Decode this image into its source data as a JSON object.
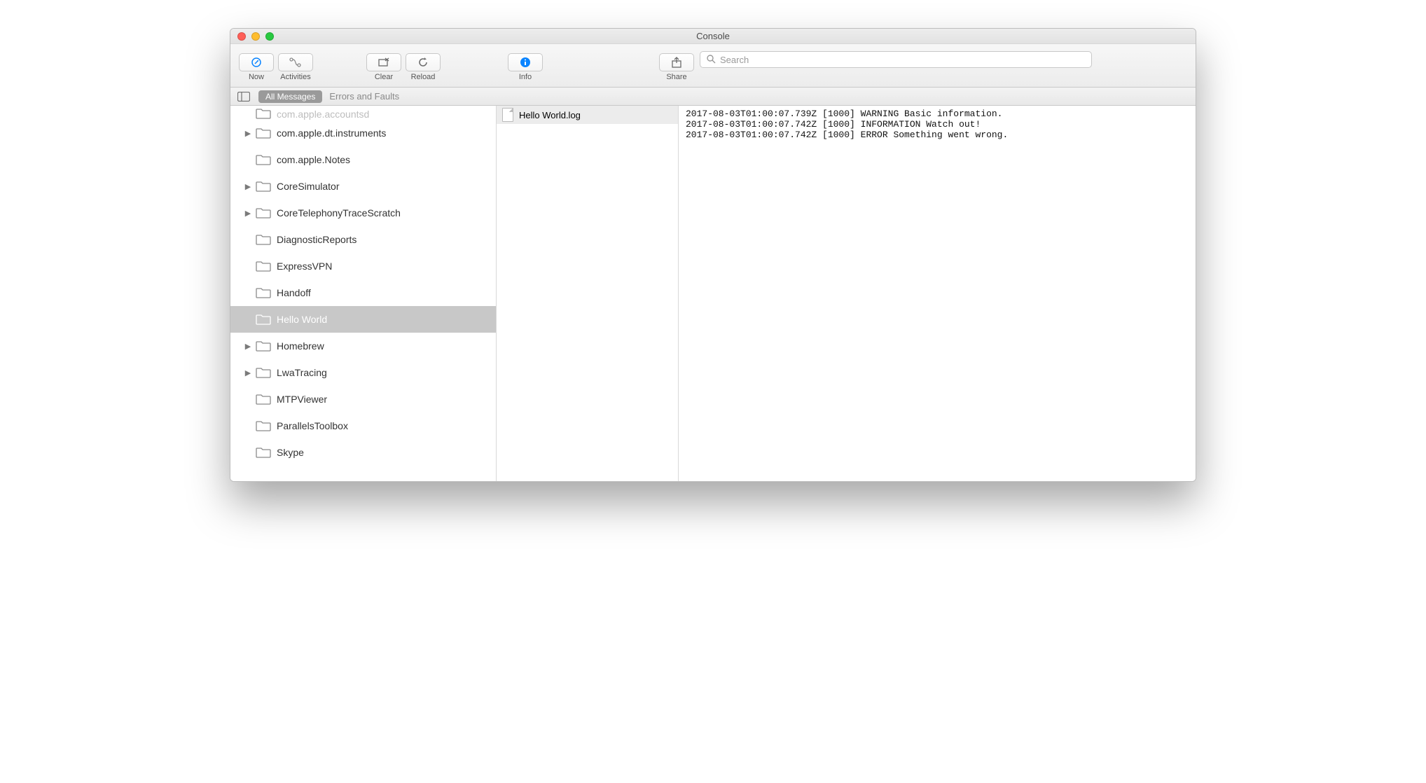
{
  "window": {
    "title": "Console"
  },
  "toolbar": {
    "now": "Now",
    "activities": "Activities",
    "clear": "Clear",
    "reload": "Reload",
    "info": "Info",
    "share": "Share",
    "search_placeholder": "Search"
  },
  "filter": {
    "all_messages": "All Messages",
    "errors_and_faults": "Errors and Faults"
  },
  "sidebar": {
    "items": [
      {
        "label": "com.apple.accountsd",
        "expandable": false,
        "selected": false,
        "topcut": true
      },
      {
        "label": "com.apple.dt.instruments",
        "expandable": true,
        "selected": false
      },
      {
        "label": "com.apple.Notes",
        "expandable": false,
        "selected": false
      },
      {
        "label": "CoreSimulator",
        "expandable": true,
        "selected": false
      },
      {
        "label": "CoreTelephonyTraceScratch",
        "expandable": true,
        "selected": false
      },
      {
        "label": "DiagnosticReports",
        "expandable": false,
        "selected": false
      },
      {
        "label": "ExpressVPN",
        "expandable": false,
        "selected": false
      },
      {
        "label": "Handoff",
        "expandable": false,
        "selected": false
      },
      {
        "label": "Hello World",
        "expandable": false,
        "selected": true
      },
      {
        "label": "Homebrew",
        "expandable": true,
        "selected": false
      },
      {
        "label": "LwaTracing",
        "expandable": true,
        "selected": false
      },
      {
        "label": "MTPViewer",
        "expandable": false,
        "selected": false
      },
      {
        "label": "ParallelsToolbox",
        "expandable": false,
        "selected": false
      },
      {
        "label": "Skype",
        "expandable": false,
        "selected": false
      }
    ]
  },
  "filelist": {
    "items": [
      {
        "name": "Hello World.log",
        "selected": true
      }
    ]
  },
  "log": {
    "lines": [
      "2017-08-03T01:00:07.739Z [1000] WARNING Basic information.",
      "2017-08-03T01:00:07.742Z [1000] INFORMATION Watch out!",
      "2017-08-03T01:00:07.742Z [1000] ERROR Something went wrong."
    ]
  }
}
